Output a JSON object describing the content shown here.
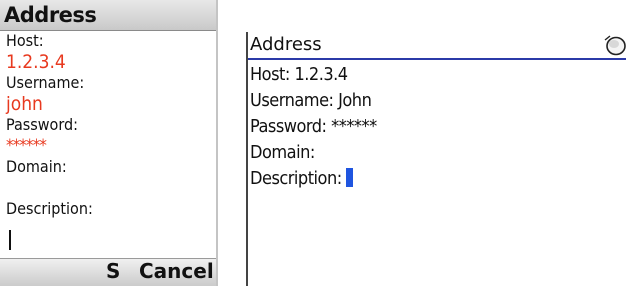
{
  "left": {
    "title": "Address",
    "host_label": "Host:",
    "host_value": "1.2.3.4",
    "username_label": "Username:",
    "username_value": "john",
    "password_label": "Password:",
    "password_value": "******",
    "domain_label": "Domain:",
    "description_label": "Description:",
    "softkeys": {
      "left": "S",
      "right": "Cancel"
    }
  },
  "right": {
    "title": "Address",
    "title_icon": "disc-icon",
    "rows": {
      "host": "Host: 1.2.3.4",
      "username": "Username: John",
      "password": "Password: ******",
      "domain": "Domain:",
      "description": "Description:"
    }
  },
  "colors": {
    "value_text": "#e8391f",
    "cursor_blue": "#1f55e0",
    "title_underline": "#2b3aa8"
  }
}
